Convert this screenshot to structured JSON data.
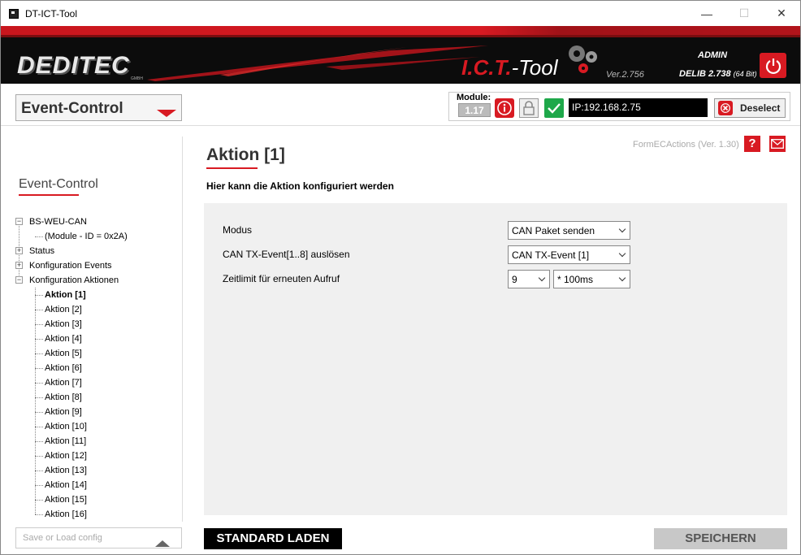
{
  "window": {
    "title": "DT-ICT-Tool",
    "minimize": "—",
    "maximize": "☐",
    "close": "✕"
  },
  "header": {
    "brand": "DEDITEC",
    "brand_sub": "GMBH",
    "ict_prefix": "I.C.T.",
    "ict_suffix": "-Tool",
    "version": "Ver.2.756",
    "user": "ADMIN",
    "delib": "DELIB 2.738",
    "delib_bits": "(64 Bit)"
  },
  "toolbar": {
    "section_select": "Event-Control",
    "module_label": "Module:",
    "module_number": "1.17",
    "ip": "IP:192.168.2.75",
    "deselect_label": "Deselect"
  },
  "nav": {
    "title": "Event-Control",
    "tree": {
      "root": "BS-WEU-CAN",
      "module_id": "(Module - ID = 0x2A)",
      "status": "Status",
      "config_events": "Konfiguration Events",
      "config_actions": "Konfiguration Aktionen",
      "actions": [
        "Aktion [1]",
        "Aktion [2]",
        "Aktion [3]",
        "Aktion [4]",
        "Aktion [5]",
        "Aktion [6]",
        "Aktion [7]",
        "Aktion [8]",
        "Aktion [9]",
        "Aktion [10]",
        "Aktion [11]",
        "Aktion [12]",
        "Aktion [13]",
        "Aktion [14]",
        "Aktion [15]",
        "Aktion [16]"
      ]
    },
    "config_placeholder": "Save or Load config"
  },
  "main": {
    "title": "Aktion [1]",
    "form_version": "FormECActions (Ver. 1.30)",
    "help": "?",
    "subtitle": "Hier kann die Aktion konfiguriert werden",
    "fields": {
      "modus_label": "Modus",
      "modus_value": "CAN Paket senden",
      "tx_label": "CAN TX-Event[1..8] auslösen",
      "tx_value": "CAN TX-Event [1]",
      "time_label": "Zeitlimit für erneuten Aufruf",
      "time_value": "9",
      "time_unit": "* 100ms"
    },
    "btn_default": "STANDARD LADEN",
    "btn_save": "SPEICHERN"
  },
  "colors": {
    "accent": "#d81a22",
    "header_bg": "#0c0c0c",
    "ok_green": "#1ea84a",
    "panel_bg": "#f0f0f0"
  }
}
